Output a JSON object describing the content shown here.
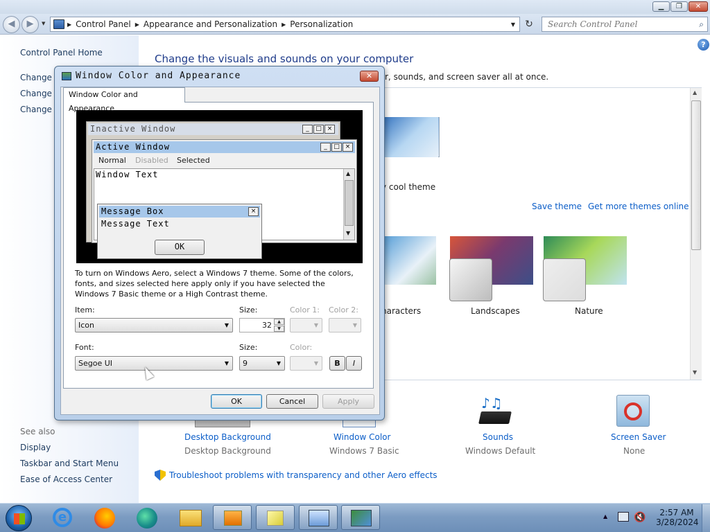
{
  "window": {
    "minimize": "▁",
    "maximize": "❐",
    "close": "✕"
  },
  "nav": {
    "back": "◀",
    "forward": "▶",
    "breadcrumb": [
      "Control Panel",
      "Appearance and Personalization",
      "Personalization"
    ],
    "refresh": "↻",
    "search_placeholder": "Search Control Panel"
  },
  "left_nav": {
    "home": "Control Panel Home",
    "links": [
      "Change d",
      "Change m",
      "Change y"
    ],
    "see_also": "See also",
    "see_also_links": [
      "Display",
      "Taskbar and Start Menu",
      "Ease of Access Center"
    ]
  },
  "main": {
    "heading": "Change the visuals and sounds on your computer",
    "subtext": "r, sounds, and screen saver all at once.",
    "my_theme_label": "y cool theme",
    "save_theme": "Save theme",
    "get_more": "Get more themes online",
    "themes": [
      "haracters",
      "Landscapes",
      "Nature"
    ],
    "bottom": [
      {
        "title": "Desktop Background",
        "value": "Desktop Background"
      },
      {
        "title": "Window Color",
        "value": "Windows 7 Basic"
      },
      {
        "title": "Sounds",
        "value": "Windows Default"
      },
      {
        "title": "Screen Saver",
        "value": "None"
      }
    ],
    "troubleshoot": "Troubleshoot problems with transparency and other Aero effects"
  },
  "dialog": {
    "title": "Window Color and Appearance",
    "tab": "Window Color and Appearance",
    "preview": {
      "inactive": "Inactive Window",
      "active": "Active Window",
      "menu": {
        "normal": "Normal",
        "disabled": "Disabled",
        "selected": "Selected"
      },
      "window_text": "Window Text",
      "msgbox_title": "Message Box",
      "msgbox_text": "Message Text",
      "msgbox_ok": "OK"
    },
    "info": "To turn on Windows Aero, select a Windows 7 theme.  Some of the colors, fonts, and sizes selected here apply only if you have selected the Windows 7 Basic theme or a High Contrast theme.",
    "item_label": "Item:",
    "item_value": "Icon",
    "size_label": "Size:",
    "size_value": "32",
    "color1_label": "Color 1:",
    "color2_label": "Color 2:",
    "font_label": "Font:",
    "font_value": "Segoe UI",
    "font_size_label": "Size:",
    "font_size_value": "9",
    "font_color_label": "Color:",
    "bold": "B",
    "italic": "I",
    "ok": "OK",
    "cancel": "Cancel",
    "apply": "Apply"
  },
  "taskbar": {
    "time": "2:57 AM",
    "date": "3/28/2024",
    "tray_arrow": "▲"
  },
  "colors": {
    "link": "#0c5ec8",
    "heading": "#1e3b8a",
    "titlebar_active": "#a6c7ea"
  }
}
